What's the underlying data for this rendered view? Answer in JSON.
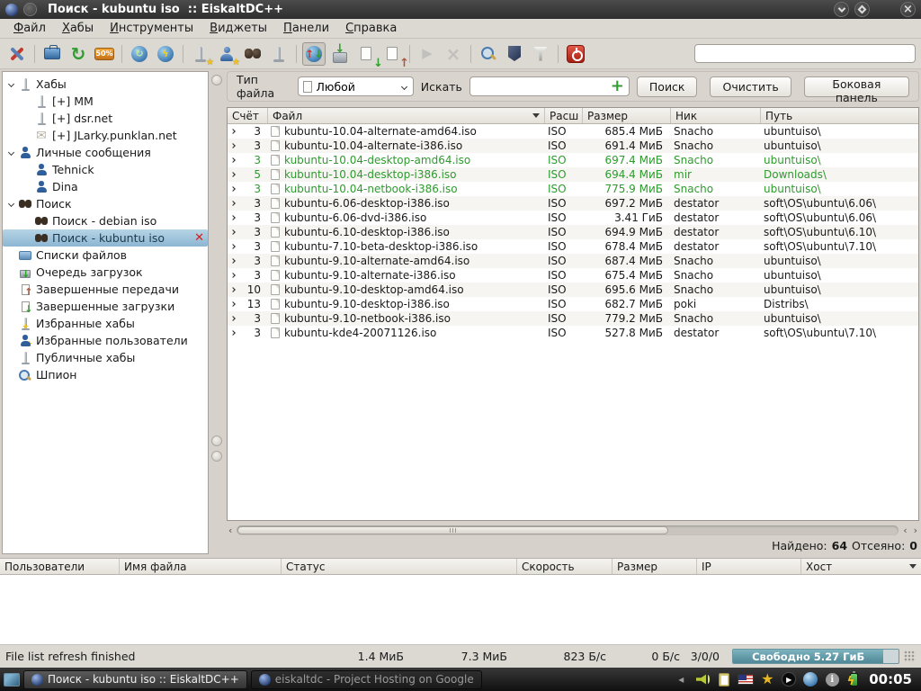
{
  "window": {
    "title": "Поиск - kubuntu iso  :: EiskaltDC++"
  },
  "menubar": {
    "items": [
      "Файл",
      "Хабы",
      "Инструменты",
      "Виджеты",
      "Панели",
      "Справка"
    ]
  },
  "toolbar": {
    "icons": [
      {
        "name": "settings",
        "sep_after": true
      },
      {
        "name": "open-filelist"
      },
      {
        "name": "refresh-filelist"
      },
      {
        "name": "hash-progress",
        "badge": "50%",
        "sep_after": true
      },
      {
        "name": "reconnect"
      },
      {
        "name": "quick-connect",
        "sep_after": true
      },
      {
        "name": "favorite-hubs"
      },
      {
        "name": "favorite-users"
      },
      {
        "name": "search"
      },
      {
        "name": "public-hubs",
        "sep_after": true
      },
      {
        "name": "transfers-toggle",
        "pressed": true
      },
      {
        "name": "download-queue"
      },
      {
        "name": "finished-downloads"
      },
      {
        "name": "finished-uploads",
        "sep_after": true
      },
      {
        "name": "adl-search",
        "disabled": true
      },
      {
        "name": "close-wiget",
        "disabled": true,
        "sep_after": true
      },
      {
        "name": "search-spy"
      },
      {
        "name": "antispam"
      },
      {
        "name": "filter",
        "sep_after": true
      },
      {
        "name": "quit"
      }
    ],
    "quick_search_value": ""
  },
  "sidebar": {
    "items": [
      {
        "label": "Хабы",
        "icon": "hub-icon",
        "level": 0,
        "expanded": true
      },
      {
        "label": "[+] MM",
        "icon": "hub-icon",
        "level": 1
      },
      {
        "label": "[+] dsr.net",
        "icon": "hub-icon",
        "level": 1
      },
      {
        "label": "[+] JLarky.punklan.net",
        "icon": "mail-icon",
        "level": 1
      },
      {
        "label": "Личные сообщения",
        "icon": "user-icon",
        "level": 0,
        "expanded": true
      },
      {
        "label": "Tehnick",
        "icon": "user-icon",
        "level": 1
      },
      {
        "label": "Dina",
        "icon": "user-icon",
        "level": 1
      },
      {
        "label": "Поиск",
        "icon": "binoculars-icon",
        "level": 0,
        "expanded": true
      },
      {
        "label": "Поиск - debian iso",
        "icon": "binoculars-icon",
        "level": 1
      },
      {
        "label": "Поиск - kubuntu iso",
        "icon": "binoculars-icon",
        "level": 1,
        "selected": true,
        "closable": true
      },
      {
        "label": "Списки файлов",
        "icon": "filelist-icon",
        "level": 0
      },
      {
        "label": "Очередь загрузок",
        "icon": "download-queue-icon",
        "level": 0
      },
      {
        "label": "Завершенные передачи",
        "icon": "finished-uploads-icon",
        "level": 0
      },
      {
        "label": "Завершенные загрузки",
        "icon": "finished-downloads-icon",
        "level": 0
      },
      {
        "label": "Избранные хабы",
        "icon": "hub-star-icon",
        "level": 0
      },
      {
        "label": "Избранные пользователи",
        "icon": "user-star-icon",
        "level": 0
      },
      {
        "label": "Публичные хабы",
        "icon": "hub-icon",
        "level": 0
      },
      {
        "label": "Шпион",
        "icon": "spy-icon",
        "level": 0
      }
    ]
  },
  "search_panel": {
    "file_type_label": "Тип файла",
    "file_type_value": "Любой",
    "search_label": "Искать",
    "search_value": "",
    "search_button": "Поиск",
    "clear_button": "Очистить",
    "side_panel_button": "Боковая панель"
  },
  "results": {
    "columns": [
      "Счёт",
      "Файл",
      "Расш",
      "Размер",
      "Ник",
      "Путь"
    ],
    "rows": [
      {
        "count": "3",
        "file": "kubuntu-10.04-alternate-amd64.iso",
        "ext": "ISO",
        "size": "685.4 МиБ",
        "nick": "Snacho",
        "path": "ubuntuiso\\",
        "green": false
      },
      {
        "count": "3",
        "file": "kubuntu-10.04-alternate-i386.iso",
        "ext": "ISO",
        "size": "691.4 МиБ",
        "nick": "Snacho",
        "path": "ubuntuiso\\",
        "green": false
      },
      {
        "count": "3",
        "file": "kubuntu-10.04-desktop-amd64.iso",
        "ext": "ISO",
        "size": "697.4 МиБ",
        "nick": "Snacho",
        "path": "ubuntuiso\\",
        "green": true
      },
      {
        "count": "5",
        "file": "kubuntu-10.04-desktop-i386.iso",
        "ext": "ISO",
        "size": "694.4 МиБ",
        "nick": "mir",
        "path": "Downloads\\",
        "green": true
      },
      {
        "count": "3",
        "file": "kubuntu-10.04-netbook-i386.iso",
        "ext": "ISO",
        "size": "775.9 МиБ",
        "nick": "Snacho",
        "path": "ubuntuiso\\",
        "green": true
      },
      {
        "count": "3",
        "file": "kubuntu-6.06-desktop-i386.iso",
        "ext": "ISO",
        "size": "697.2 МиБ",
        "nick": "destator",
        "path": "soft\\OS\\ubuntu\\6.06\\",
        "green": false
      },
      {
        "count": "3",
        "file": "kubuntu-6.06-dvd-i386.iso",
        "ext": "ISO",
        "size": "3.41 ГиБ",
        "nick": "destator",
        "path": "soft\\OS\\ubuntu\\6.06\\",
        "green": false
      },
      {
        "count": "3",
        "file": "kubuntu-6.10-desktop-i386.iso",
        "ext": "ISO",
        "size": "694.9 МиБ",
        "nick": "destator",
        "path": "soft\\OS\\ubuntu\\6.10\\",
        "green": false
      },
      {
        "count": "3",
        "file": "kubuntu-7.10-beta-desktop-i386.iso",
        "ext": "ISO",
        "size": "678.4 МиБ",
        "nick": "destator",
        "path": "soft\\OS\\ubuntu\\7.10\\",
        "green": false
      },
      {
        "count": "3",
        "file": "kubuntu-9.10-alternate-amd64.iso",
        "ext": "ISO",
        "size": "687.4 МиБ",
        "nick": "Snacho",
        "path": "ubuntuiso\\",
        "green": false
      },
      {
        "count": "3",
        "file": "kubuntu-9.10-alternate-i386.iso",
        "ext": "ISO",
        "size": "675.4 МиБ",
        "nick": "Snacho",
        "path": "ubuntuiso\\",
        "green": false
      },
      {
        "count": "10",
        "file": "kubuntu-9.10-desktop-amd64.iso",
        "ext": "ISO",
        "size": "695.6 МиБ",
        "nick": "Snacho",
        "path": "ubuntuiso\\",
        "green": false
      },
      {
        "count": "13",
        "file": "kubuntu-9.10-desktop-i386.iso",
        "ext": "ISO",
        "size": "682.7 МиБ",
        "nick": "poki",
        "path": "Distribs\\",
        "green": false
      },
      {
        "count": "3",
        "file": "kubuntu-9.10-netbook-i386.iso",
        "ext": "ISO",
        "size": "779.2 МиБ",
        "nick": "Snacho",
        "path": "ubuntuiso\\",
        "green": false
      },
      {
        "count": "3",
        "file": "kubuntu-kde4-20071126.iso",
        "ext": "ISO",
        "size": "527.8 МиБ",
        "nick": "destator",
        "path": "soft\\OS\\ubuntu\\7.10\\",
        "green": false
      }
    ],
    "found_label": "Найдено:",
    "found_value": "64",
    "filtered_label": "Отсеяно:",
    "filtered_value": "0"
  },
  "transfers": {
    "columns": [
      "Пользователи",
      "Имя файла",
      "Статус",
      "Скорость",
      "Размер",
      "IP",
      "Хост"
    ]
  },
  "statusbar": {
    "message": "File list refresh finished",
    "stats": [
      "1.4 МиБ",
      "7.3 МиБ",
      "823 Б/с",
      "0 Б/с",
      "3/0/0"
    ],
    "free_space_label": "Свободно 5.27 ГиБ"
  },
  "taskbar": {
    "tasks": [
      {
        "label": "Поиск - kubuntu iso  :: EiskaltDC++",
        "active": true
      },
      {
        "label": "eiskaltdc - Project Hosting on Google",
        "active": false
      }
    ],
    "tray": [
      "collapse",
      "volume",
      "clipboard",
      "keyboard-flag-us",
      "star",
      "media-player",
      "network",
      "info",
      "battery"
    ],
    "clock": "00:05"
  }
}
